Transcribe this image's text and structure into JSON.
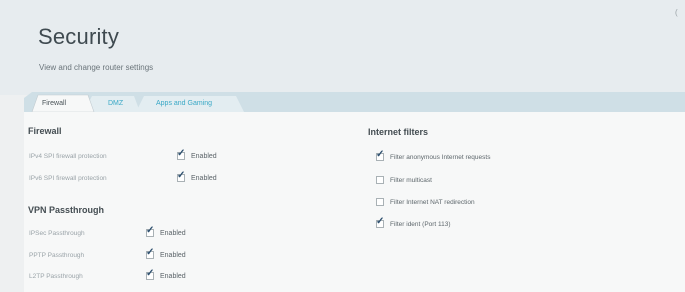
{
  "header": {
    "title": "Security",
    "subtitle": "View and change router settings",
    "corner_glyph": "("
  },
  "tabs": [
    {
      "label": "Firewall",
      "active": true
    },
    {
      "label": "DMZ",
      "active": false
    },
    {
      "label": "Apps and Gaming",
      "active": false
    }
  ],
  "firewall": {
    "title": "Firewall",
    "rows": [
      {
        "label": "IPv4 SPI firewall protection",
        "checked": true,
        "value": "Enabled"
      },
      {
        "label": "IPv6 SPI firewall protection",
        "checked": true,
        "value": "Enabled"
      }
    ]
  },
  "vpn": {
    "title": "VPN Passthrough",
    "rows": [
      {
        "label": "IPSec Passthrough",
        "checked": true,
        "value": "Enabled"
      },
      {
        "label": "PPTP Passthrough",
        "checked": true,
        "value": "Enabled"
      },
      {
        "label": "L2TP Passthrough",
        "checked": true,
        "value": "Enabled"
      }
    ]
  },
  "internet_filters": {
    "title": "Internet filters",
    "items": [
      {
        "label": "Filter anonymous Internet requests",
        "checked": true
      },
      {
        "label": "Filter multicast",
        "checked": false
      },
      {
        "label": "Filter Internet NAT redirection",
        "checked": false
      },
      {
        "label": "Filter ident (Port 113)",
        "checked": true
      }
    ]
  },
  "colors": {
    "accent": "#39a8c6",
    "header_bg": "#e7ecef",
    "panel_bg": "#f7f8f8",
    "tab_strip": "#c9dbe3",
    "checkmark": "#2d4f6e"
  },
  "icons": {
    "checkmark": "checkmark-icon"
  }
}
